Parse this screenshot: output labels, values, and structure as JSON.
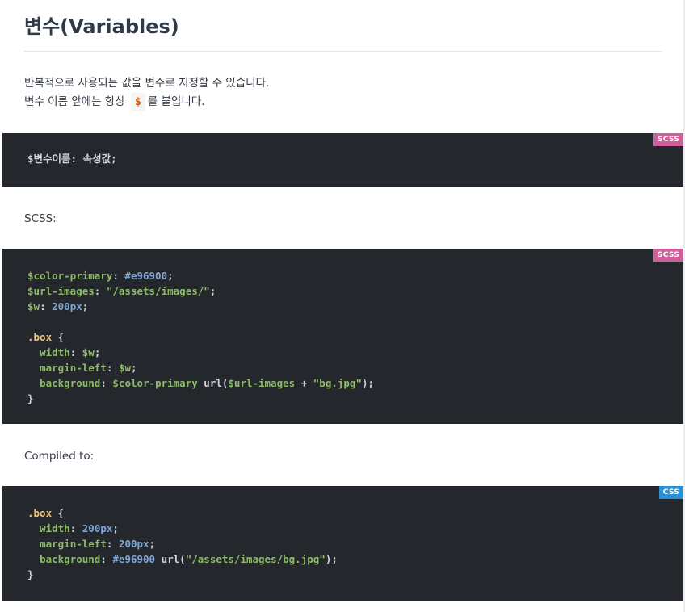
{
  "page": {
    "title": "변수(Variables)",
    "intro_line1": "반복적으로 사용되는 값을 변수로 지정할 수 있습니다.",
    "intro_line2_before": "변수 이름 앞에는 항상",
    "intro_inline_code": "$",
    "intro_line2_after": "를 붙입니다."
  },
  "blocks": {
    "syntax": {
      "lang": "SCSS",
      "badge_color": "#d05e9b",
      "line1": "$변수이름: 속성값;"
    },
    "scss_label": "SCSS:",
    "scss": {
      "lang": "SCSS",
      "badge_color": "#d05e9b",
      "l1_var": "$color-primary",
      "l1_colon": ": ",
      "l1_val": "#e96900",
      "l1_end": ";",
      "l2_var": "$url-images",
      "l2_colon": ": ",
      "l2_val": "\"/assets/images/\"",
      "l2_end": ";",
      "l3_var": "$w",
      "l3_colon": ": ",
      "l3_val": "200px",
      "l3_end": ";",
      "l5_sel": ".box",
      "l5_brace": " {",
      "l6_prop": "width",
      "l6_colon": ": ",
      "l6_val": "$w",
      "l6_end": ";",
      "l7_prop": "margin-left",
      "l7_colon": ": ",
      "l7_val": "$w",
      "l7_end": ";",
      "l8_prop": "background",
      "l8_colon": ": ",
      "l8_var1": "$color-primary",
      "l8_url": " url(",
      "l8_var2": "$url-images",
      "l8_plus": " + ",
      "l8_str": "\"bg.jpg\"",
      "l8_end": ");",
      "l9_close": "}"
    },
    "compiled_label": "Compiled to:",
    "css": {
      "lang": "CSS",
      "badge_color": "#2b8fd6",
      "l1_sel": ".box",
      "l1_brace": " {",
      "l2_prop": "width",
      "l2_colon": ": ",
      "l2_val": "200px",
      "l2_end": ";",
      "l3_prop": "margin-left",
      "l3_colon": ": ",
      "l3_val": "200px",
      "l3_end": ";",
      "l4_prop": "background",
      "l4_colon": ": ",
      "l4_val": "#e96900",
      "l4_url": " url(",
      "l4_str": "\"/assets/images/bg.jpg\"",
      "l4_end": ");",
      "l5_close": "}"
    }
  }
}
